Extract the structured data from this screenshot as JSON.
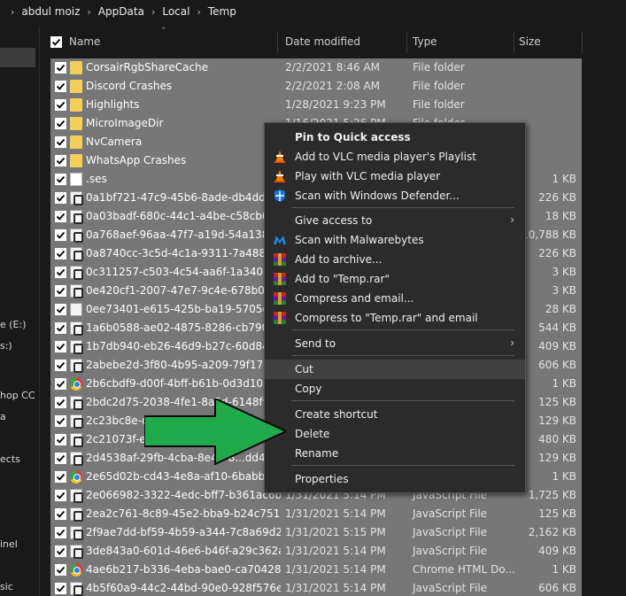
{
  "breadcrumb": [
    "abdul moiz",
    "AppData",
    "Local",
    "Temp"
  ],
  "nav": [
    "e (E:)",
    "s:)",
    "hop CC",
    "a",
    "ects",
    "inel",
    "sic"
  ],
  "columns": {
    "name": "Name",
    "date": "Date modified",
    "type": "Type",
    "size": "Size"
  },
  "rows": [
    {
      "name": "CorsairRgbShareCache",
      "date": "2/2/2021 8:46 AM",
      "type": "File folder",
      "size": "",
      "icon": "folder-icon"
    },
    {
      "name": "Discord Crashes",
      "date": "2/2/2021 2:08 AM",
      "type": "File folder",
      "size": "",
      "icon": "folder-icon"
    },
    {
      "name": "Highlights",
      "date": "1/28/2021 9:23 PM",
      "type": "File folder",
      "size": "",
      "icon": "folder-icon"
    },
    {
      "name": "MicroImageDir",
      "date": "1/16/2021 5:26 PM",
      "type": "File folder",
      "size": "",
      "icon": "folder-icon"
    },
    {
      "name": "NvCamera",
      "date": "",
      "type": "",
      "size": "",
      "icon": "folder-icon"
    },
    {
      "name": "WhatsApp Crashes",
      "date": "",
      "type": "",
      "size": "",
      "icon": "folder-icon"
    },
    {
      "name": ".ses",
      "date": "",
      "type": "",
      "size": "1 KB",
      "icon": "file-icon"
    },
    {
      "name": "0a1bf721-47c9-45b6-8ade-db4ddf9bd...",
      "date": "",
      "type": "",
      "size": "226 KB",
      "icon": "js-file-icon"
    },
    {
      "name": "0a03badf-680c-44c1-a4be-c58cb6e48...",
      "date": "",
      "type": "",
      "size": "18 KB",
      "icon": "js-file-icon"
    },
    {
      "name": "0a768aef-96aa-47f7-a19d-54a138d7ec...",
      "date": "",
      "type": "",
      "size": "10,788 KB",
      "icon": "js-file-icon"
    },
    {
      "name": "0a8740cc-3c5d-4c1a-9311-7a48807abf...",
      "date": "",
      "type": "",
      "size": "226 KB",
      "icon": "js-file-icon"
    },
    {
      "name": "0c311257-c503-4c54-aa6f-1a340b315b...",
      "date": "",
      "type": "",
      "size": "3 KB",
      "icon": "js-file-icon"
    },
    {
      "name": "0e420cf1-2007-47e7-9c4e-678b03f117...",
      "date": "",
      "type": "",
      "size": "3 KB",
      "icon": "js-file-icon"
    },
    {
      "name": "0ee73401-e615-425b-ba19-5705ccc37...",
      "date": "",
      "type": "",
      "size": "28 KB",
      "icon": "html-file-icon"
    },
    {
      "name": "1a6b0588-ae02-4875-8286-cb790e6a09...",
      "date": "",
      "type": "",
      "size": "544 KB",
      "icon": "js-file-icon"
    },
    {
      "name": "1b7db940-eb26-46d9-b27c-60d848f13...",
      "date": "",
      "type": "",
      "size": "409 KB",
      "icon": "js-file-icon"
    },
    {
      "name": "2abebe2d-3f80-4b95-a209-79f17bec94...",
      "date": "",
      "type": "",
      "size": "606 KB",
      "icon": "js-file-icon"
    },
    {
      "name": "2b6cbdf9-d00f-4bff-b61b-0d3d10a20c...",
      "date": "",
      "type": "",
      "size": "1 KB",
      "icon": "chrome-icon"
    },
    {
      "name": "2bdc2d75-2038-4fe1-8a5d-6148f99ffd...",
      "date": "",
      "type": "",
      "size": "125 KB",
      "icon": "js-file-icon"
    },
    {
      "name": "2c23bc8e-d4...",
      "date": "",
      "type": "",
      "size": "129 KB",
      "icon": "js-file-icon"
    },
    {
      "name": "2c21073f-eff...",
      "date": "",
      "type": "",
      "size": "480 KB",
      "icon": "js-file-icon"
    },
    {
      "name": "2d4538af-29fb-4cba-8e43-8...dd4923...",
      "date": "",
      "type": "",
      "size": "129 KB",
      "icon": "js-file-icon"
    },
    {
      "name": "2e65d02b-cd43-4e8a-af10-6babbaab4...",
      "date": "",
      "type": "",
      "size": "1 KB",
      "icon": "chrome-icon"
    },
    {
      "name": "2e066982-3322-4edc-bff7-b361ac6b66...",
      "date": "1/31/2021 5:14 PM",
      "type": "JavaScript File",
      "size": "1,725 KB",
      "icon": "js-file-icon"
    },
    {
      "name": "2ea2c761-8c89-45e2-bba9-b24c75190...",
      "date": "1/31/2021 5:14 PM",
      "type": "JavaScript File",
      "size": "125 KB",
      "icon": "js-file-icon"
    },
    {
      "name": "2f9ae7dd-bf59-4b59-a344-7c8a69d201...",
      "date": "1/31/2021 5:15 PM",
      "type": "JavaScript File",
      "size": "2,162 KB",
      "icon": "js-file-icon"
    },
    {
      "name": "3de843a0-601d-46e6-b46f-a29c362ace...",
      "date": "1/31/2021 5:14 PM",
      "type": "JavaScript File",
      "size": "409 KB",
      "icon": "js-file-icon"
    },
    {
      "name": "4ae6b217-b336-4eba-bae0-ca70428f8e...",
      "date": "1/31/2021 5:14 PM",
      "type": "Chrome HTML Do...",
      "size": "1 KB",
      "icon": "chrome-icon"
    },
    {
      "name": "4b5f60a9-44c2-44bd-90e0-928f576ecd...",
      "date": "1/31/2021 5:14 PM",
      "type": "JavaScript File",
      "size": "606 KB",
      "icon": "js-file-icon"
    }
  ],
  "context_menu": {
    "items": [
      {
        "label": "Pin to Quick access",
        "bold": true,
        "icon": "",
        "submenu": false
      },
      {
        "label": "Add to VLC media player's Playlist",
        "bold": false,
        "icon": "vlc-icon",
        "submenu": false
      },
      {
        "label": "Play with VLC media player",
        "bold": false,
        "icon": "vlc-icon",
        "submenu": false
      },
      {
        "label": "Scan with Windows Defender...",
        "bold": false,
        "icon": "windows-defender-icon",
        "submenu": false
      },
      {
        "sep": true
      },
      {
        "label": "Give access to",
        "bold": false,
        "icon": "",
        "submenu": true
      },
      {
        "label": "Scan with Malwarebytes",
        "bold": false,
        "icon": "malwarebytes-icon",
        "submenu": false
      },
      {
        "label": "Add to archive...",
        "bold": false,
        "icon": "winrar-icon",
        "submenu": false
      },
      {
        "label": "Add to \"Temp.rar\"",
        "bold": false,
        "icon": "winrar-icon",
        "submenu": false
      },
      {
        "label": "Compress and email...",
        "bold": false,
        "icon": "winrar-icon",
        "submenu": false
      },
      {
        "label": "Compress to \"Temp.rar\" and email",
        "bold": false,
        "icon": "winrar-icon",
        "submenu": false
      },
      {
        "sep": true
      },
      {
        "label": "Send to",
        "bold": false,
        "icon": "",
        "submenu": true
      },
      {
        "sep": true
      },
      {
        "label": "Cut",
        "bold": false,
        "icon": "",
        "submenu": false,
        "hover": true
      },
      {
        "label": "Copy",
        "bold": false,
        "icon": "",
        "submenu": false
      },
      {
        "sep": true
      },
      {
        "label": "Create shortcut",
        "bold": false,
        "icon": "",
        "submenu": false
      },
      {
        "label": "Delete",
        "bold": false,
        "icon": "",
        "submenu": false
      },
      {
        "label": "Rename",
        "bold": false,
        "icon": "",
        "submenu": false
      },
      {
        "sep": true
      },
      {
        "label": "Properties",
        "bold": false,
        "icon": "",
        "submenu": false
      }
    ]
  },
  "colors": {
    "background": "#191919",
    "selection": "#777777",
    "menu_bg": "#2b2b2b",
    "arrow_fill": "#1faa4b"
  }
}
